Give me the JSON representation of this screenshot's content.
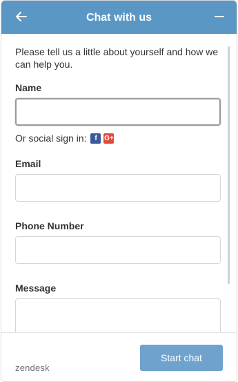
{
  "header": {
    "title": "Chat with us",
    "back_icon": "arrow-left-icon",
    "minimize_icon": "minus-icon",
    "color": "#5b97c4"
  },
  "form": {
    "intro": "Please tell us a little about yourself and how we can help you.",
    "name": {
      "label": "Name",
      "value": ""
    },
    "social": {
      "text": "Or social sign in:",
      "facebook_icon": "facebook-icon",
      "google_icon": "google-plus-icon"
    },
    "email": {
      "label": "Email",
      "value": ""
    },
    "phone": {
      "label": "Phone Number",
      "value": ""
    },
    "message": {
      "label": "Message",
      "value": ""
    }
  },
  "footer": {
    "brand": "zendesk",
    "start_button": "Start chat",
    "button_color": "#6fa3ce"
  }
}
